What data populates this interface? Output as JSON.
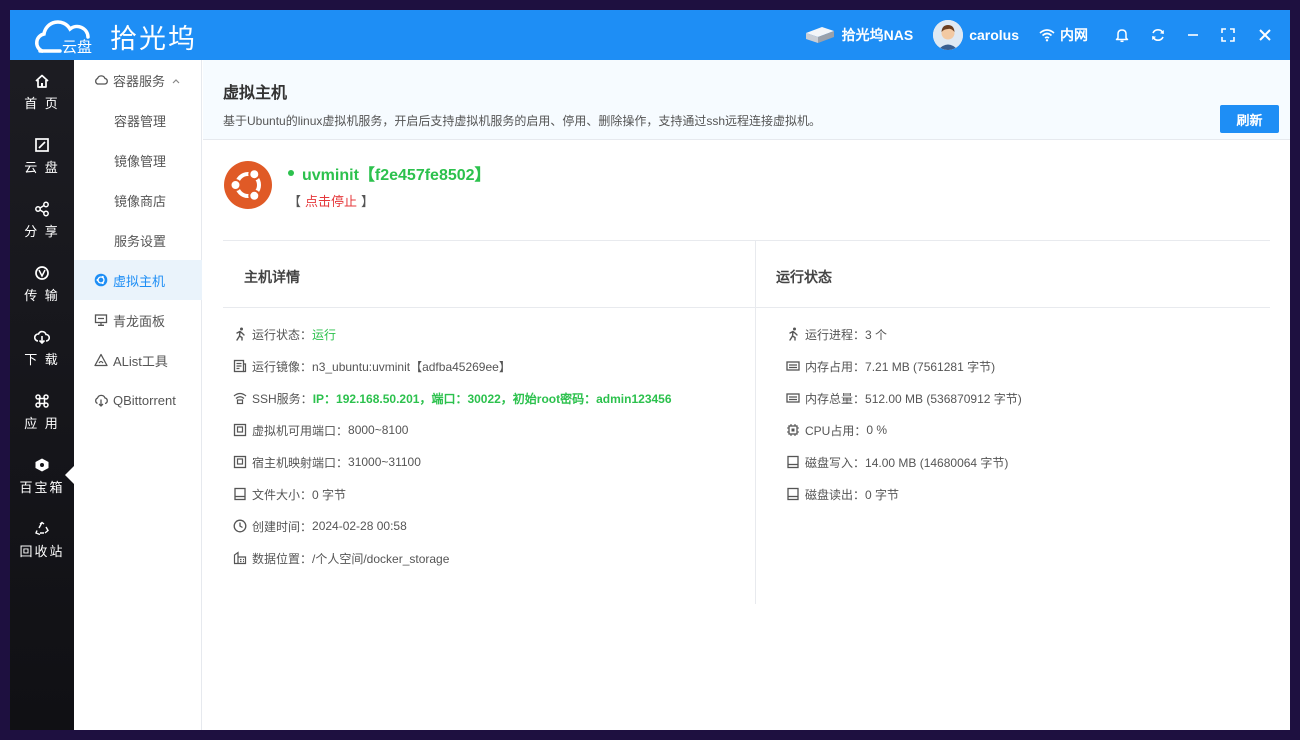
{
  "app": {
    "logo_cloud_text": "云盘",
    "logo_text": "拾光坞"
  },
  "topbar": {
    "nas_label": "拾光坞NAS",
    "username": "carolus",
    "network_label": "内网"
  },
  "sidenav": [
    {
      "label": "首 页",
      "icon": "home-icon"
    },
    {
      "label": "云 盘",
      "icon": "drive-icon"
    },
    {
      "label": "分 享",
      "icon": "share-icon"
    },
    {
      "label": "传 输",
      "icon": "transfer-icon"
    },
    {
      "label": "下 载",
      "icon": "download-icon"
    },
    {
      "label": "应 用",
      "icon": "apps-icon"
    },
    {
      "label": "百宝箱",
      "icon": "toolbox-icon"
    },
    {
      "label": "回收站",
      "icon": "recycle-icon"
    }
  ],
  "subnav": {
    "group": "容器服务",
    "group_chevron": "^",
    "children": [
      "容器管理",
      "镜像管理",
      "镜像商店",
      "服务设置"
    ],
    "items": [
      {
        "label": "虚拟主机",
        "icon": "ubuntu-icon"
      },
      {
        "label": "青龙面板",
        "icon": "monitor-icon"
      },
      {
        "label": "AList工具",
        "icon": "alist-icon"
      },
      {
        "label": "QBittorrent",
        "icon": "cloud-download-icon"
      }
    ]
  },
  "page": {
    "title": "虚拟主机",
    "description": "基于Ubuntu的linux虚拟机服务，开启后支持虚拟机服务的启用、停用、删除操作，支持通过ssh远程连接虚拟机。",
    "refresh_label": "刷新"
  },
  "vm": {
    "name": "uvminit【f2e457fe8502】",
    "action_open": "【",
    "action_label": "点击停止",
    "action_close": "】"
  },
  "details": {
    "title": "主机详情",
    "rows": [
      {
        "icon": "run-icon",
        "label": "运行状态：",
        "value": "运行"
      },
      {
        "icon": "image-icon",
        "label": "运行镜像：",
        "value": "n3_ubuntu:uvminit【adfba45269ee】"
      },
      {
        "icon": "wifi-icon",
        "label": "SSH服务：",
        "value": "IP：192.168.50.201，端口：30022，初始root密码：admin123456"
      },
      {
        "icon": "port-icon",
        "label": "虚拟机可用端口：",
        "value": "8000~8100"
      },
      {
        "icon": "port-icon",
        "label": "宿主机映射端口：",
        "value": "31000~31100"
      },
      {
        "icon": "disk-icon",
        "label": "文件大小：",
        "value": "0 字节"
      },
      {
        "icon": "clock-icon",
        "label": "创建时间：",
        "value": "2024-02-28 00:58"
      },
      {
        "icon": "folder-icon",
        "label": "数据位置：",
        "value": "/个人空间/docker_storage"
      }
    ]
  },
  "status": {
    "title": "运行状态",
    "rows": [
      {
        "icon": "run-icon",
        "label": "运行进程：",
        "value": "3 个"
      },
      {
        "icon": "memory-icon",
        "label": "内存占用：",
        "value": "7.21 MB (7561281 字节)"
      },
      {
        "icon": "memory-icon",
        "label": "内存总量：",
        "value": "512.00 MB (536870912 字节)"
      },
      {
        "icon": "cpu-icon",
        "label": "CPU占用：",
        "value": "0 %"
      },
      {
        "icon": "disk-icon",
        "label": "磁盘写入：",
        "value": "14.00 MB (14680064 字节)"
      },
      {
        "icon": "disk-icon",
        "label": "磁盘读出：",
        "value": "0 字节"
      }
    ]
  },
  "colors": {
    "accent": "#1e8ef5",
    "running": "#2cc14d",
    "stop": "#e5383b",
    "ubuntu": "#e05a26"
  }
}
